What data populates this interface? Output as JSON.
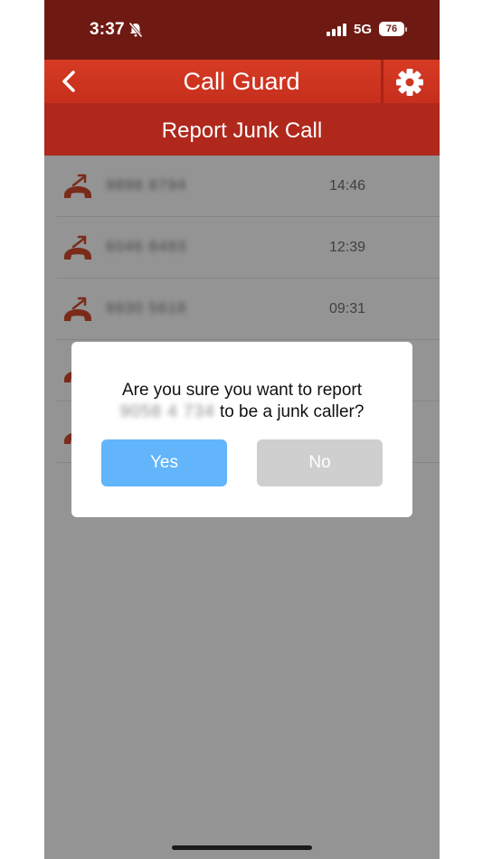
{
  "status_bar": {
    "time": "3:37",
    "network": "5G",
    "battery": "76"
  },
  "header": {
    "title": "Call Guard",
    "subtitle": "Report Junk Call"
  },
  "calls": [
    {
      "number": "9898 8794",
      "time": "14:46",
      "icon": "outgoing-call-icon"
    },
    {
      "number": "6046 8493",
      "time": "12:39",
      "icon": "outgoing-call-icon"
    },
    {
      "number": "9930 5618",
      "time": "09:31",
      "icon": "outgoing-call-icon"
    },
    {
      "number": "",
      "time": "",
      "icon": "outgoing-call-icon"
    },
    {
      "number": "",
      "time": "",
      "icon": "outgoing-call-icon"
    }
  ],
  "dialog": {
    "message_prefix": "Are you sure you want to report",
    "number": "9058 4 734",
    "message_suffix": "to be a junk caller?",
    "yes_label": "Yes",
    "no_label": "No"
  },
  "colors": {
    "status_bar": "#6e1a12",
    "header": "#d73b24",
    "subheader": "#b0271c",
    "call_icon": "#d24a2e",
    "yes_button": "#62b4fb",
    "no_button": "#cfcfcf"
  }
}
